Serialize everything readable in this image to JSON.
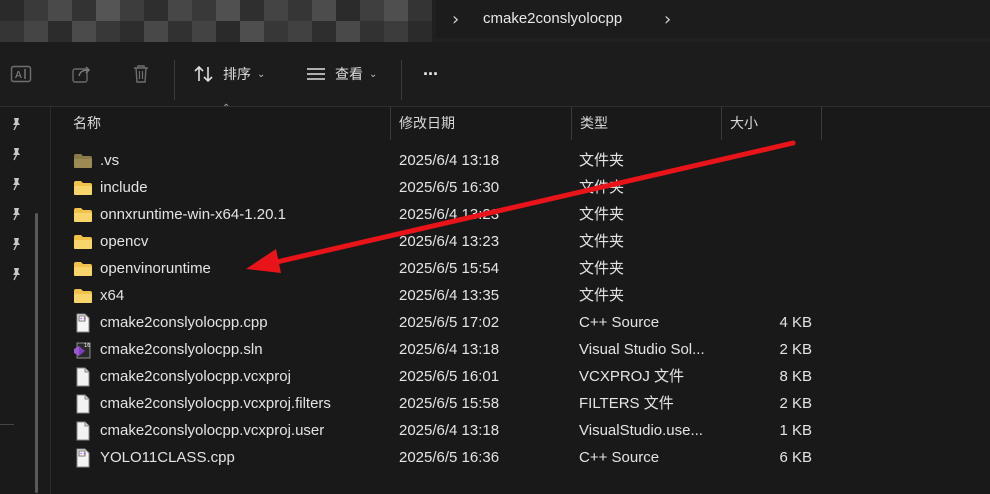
{
  "address_bar": {
    "path_segment": "cmake2conslyolocpp",
    "separator_glyph": "›"
  },
  "toolbar": {
    "sort_label": "排序",
    "view_label": "查看",
    "more_glyph": "···",
    "icons": [
      "rename-icon",
      "share-icon",
      "delete-icon",
      "sort-icon",
      "view-icon",
      "more-icon"
    ]
  },
  "columns": {
    "name": "名称",
    "date": "修改日期",
    "type": "类型",
    "size": "大小"
  },
  "files": [
    {
      "name": ".vs",
      "date": "2025/6/4 13:18",
      "type": "文件夹",
      "size": "",
      "icon": "folder-dim"
    },
    {
      "name": "include",
      "date": "2025/6/5 16:30",
      "type": "文件夹",
      "size": "",
      "icon": "folder"
    },
    {
      "name": "onnxruntime-win-x64-1.20.1",
      "date": "2025/6/4 13:23",
      "type": "文件夹",
      "size": "",
      "icon": "folder"
    },
    {
      "name": "opencv",
      "date": "2025/6/4 13:23",
      "type": "文件夹",
      "size": "",
      "icon": "folder"
    },
    {
      "name": "openvinoruntime",
      "date": "2025/6/5 15:54",
      "type": "文件夹",
      "size": "",
      "icon": "folder"
    },
    {
      "name": "x64",
      "date": "2025/6/4 13:35",
      "type": "文件夹",
      "size": "",
      "icon": "folder"
    },
    {
      "name": "cmake2conslyolocpp.cpp",
      "date": "2025/6/5 17:02",
      "type": "C++ Source",
      "size": "4 KB",
      "icon": "cpp-file"
    },
    {
      "name": "cmake2conslyolocpp.sln",
      "date": "2025/6/4 13:18",
      "type": "Visual Studio Sol...",
      "size": "2 KB",
      "icon": "sln-file"
    },
    {
      "name": "cmake2conslyolocpp.vcxproj",
      "date": "2025/6/5 16:01",
      "type": "VCXPROJ 文件",
      "size": "8 KB",
      "icon": "plain-file"
    },
    {
      "name": "cmake2conslyolocpp.vcxproj.filters",
      "date": "2025/6/5 15:58",
      "type": "FILTERS 文件",
      "size": "2 KB",
      "icon": "plain-file"
    },
    {
      "name": "cmake2conslyolocpp.vcxproj.user",
      "date": "2025/6/4 13:18",
      "type": "VisualStudio.use...",
      "size": "1 KB",
      "icon": "plain-file"
    },
    {
      "name": "YOLO11CLASS.cpp",
      "date": "2025/6/5 16:36",
      "type": "C++ Source",
      "size": "6 KB",
      "icon": "cpp-file"
    }
  ],
  "annotation": {
    "arrow_color": "#e8141a",
    "points_to": "openvinoruntime"
  },
  "colors": {
    "background": "#191919",
    "folder": "#f0c24a",
    "text": "#e4e4e4"
  }
}
